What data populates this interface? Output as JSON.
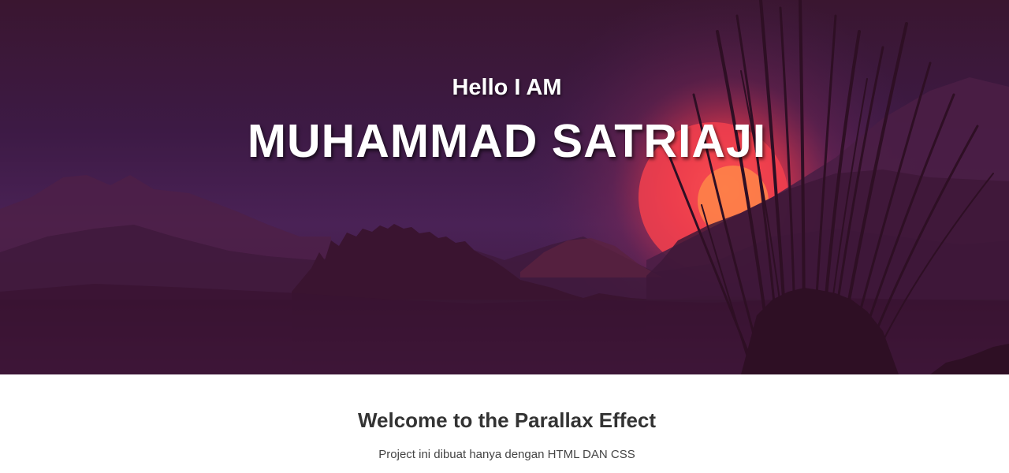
{
  "hero": {
    "greeting": "Hello I AM",
    "name": "MUHAMMAD SATRIAJI"
  },
  "content": {
    "heading": "Welcome to the Parallax Effect",
    "description": "Project ini dibuat hanya dengan HTML DAN CSS"
  },
  "colors": {
    "sky_top": "#3a1630",
    "sky_mid": "#4a2256",
    "sun": "#ff4a4a",
    "sun_core": "#ffa040",
    "hills_far": "#4e2350",
    "hills_near": "#3d1730",
    "grass": "#2e0f24",
    "heading_text": "#333333",
    "body_text": "#444444"
  }
}
